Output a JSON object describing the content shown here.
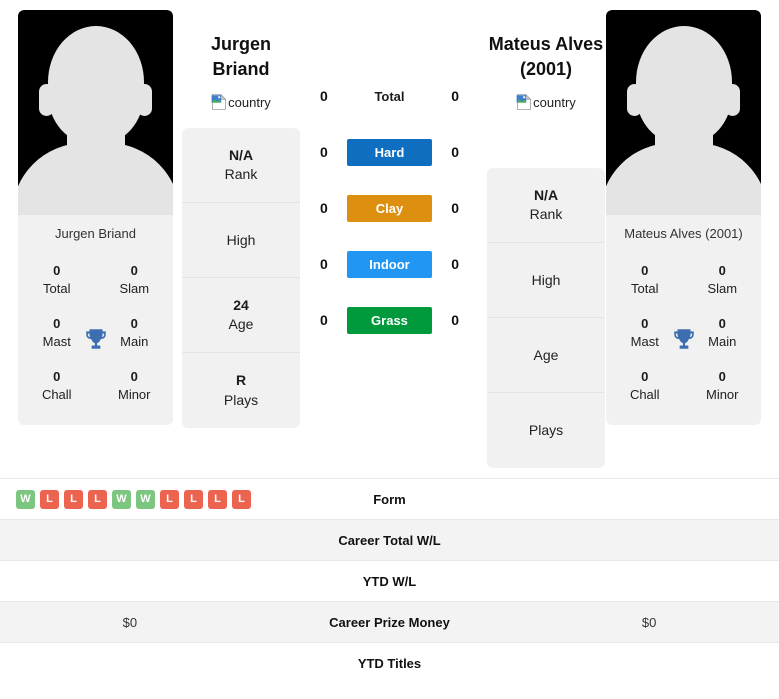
{
  "players": {
    "left": {
      "name_line1": "Jurgen",
      "name_line2": "Briand",
      "full_name": "Jurgen Briand",
      "country_alt": "country",
      "photo_caption": "Jurgen Briand",
      "titles": [
        {
          "value": "0",
          "label": "Total"
        },
        {
          "value": "0",
          "label": "Slam"
        },
        {
          "value": "0",
          "label": "Mast"
        },
        {
          "value": "0",
          "label": "Main"
        },
        {
          "value": "0",
          "label": "Chall"
        },
        {
          "value": "0",
          "label": "Minor"
        }
      ],
      "info": [
        {
          "value": "N/A",
          "label": "Rank"
        },
        {
          "value": "",
          "label": "High"
        },
        {
          "value": "24",
          "label": "Age"
        },
        {
          "value": "R",
          "label": "Plays"
        }
      ]
    },
    "right": {
      "name_line1": "Mateus Alves",
      "name_line2": "(2001)",
      "full_name": "Mateus Alves (2001)",
      "country_alt": "country",
      "photo_caption": "Mateus Alves (2001)",
      "titles": [
        {
          "value": "0",
          "label": "Total"
        },
        {
          "value": "0",
          "label": "Slam"
        },
        {
          "value": "0",
          "label": "Mast"
        },
        {
          "value": "0",
          "label": "Main"
        },
        {
          "value": "0",
          "label": "Chall"
        },
        {
          "value": "0",
          "label": "Minor"
        }
      ],
      "info": [
        {
          "value": "N/A",
          "label": "Rank"
        },
        {
          "value": "",
          "label": "High"
        },
        {
          "value": "",
          "label": "Age"
        },
        {
          "value": "",
          "label": "Plays"
        }
      ]
    }
  },
  "surfaces": [
    {
      "label": "Total",
      "left": "0",
      "right": "0",
      "color": ""
    },
    {
      "label": "Hard",
      "left": "0",
      "right": "0",
      "color": "#0f6ec0"
    },
    {
      "label": "Clay",
      "left": "0",
      "right": "0",
      "color": "#dd9010"
    },
    {
      "label": "Indoor",
      "left": "0",
      "right": "0",
      "color": "#2196f3"
    },
    {
      "label": "Grass",
      "left": "0",
      "right": "0",
      "color": "#009a3d"
    }
  ],
  "form": {
    "left_results": [
      "W",
      "L",
      "L",
      "L",
      "W",
      "W",
      "L",
      "L",
      "L",
      "L"
    ],
    "right_results": [],
    "win_color": "#7cc67f",
    "loss_color": "#ec6450"
  },
  "stats_rows": [
    {
      "label": "Form",
      "left": "",
      "right": "",
      "striped": false
    },
    {
      "label": "Career Total W/L",
      "left": "",
      "right": "",
      "striped": true
    },
    {
      "label": "YTD W/L",
      "left": "",
      "right": "",
      "striped": false
    },
    {
      "label": "Career Prize Money",
      "left": "$0",
      "right": "$0",
      "striped": true
    },
    {
      "label": "YTD Titles",
      "left": "",
      "right": "",
      "striped": false
    }
  ],
  "colors": {
    "card_bg": "#f1f1f1",
    "trophy": "#3d6fb0",
    "page_bg": "#ffffff"
  }
}
